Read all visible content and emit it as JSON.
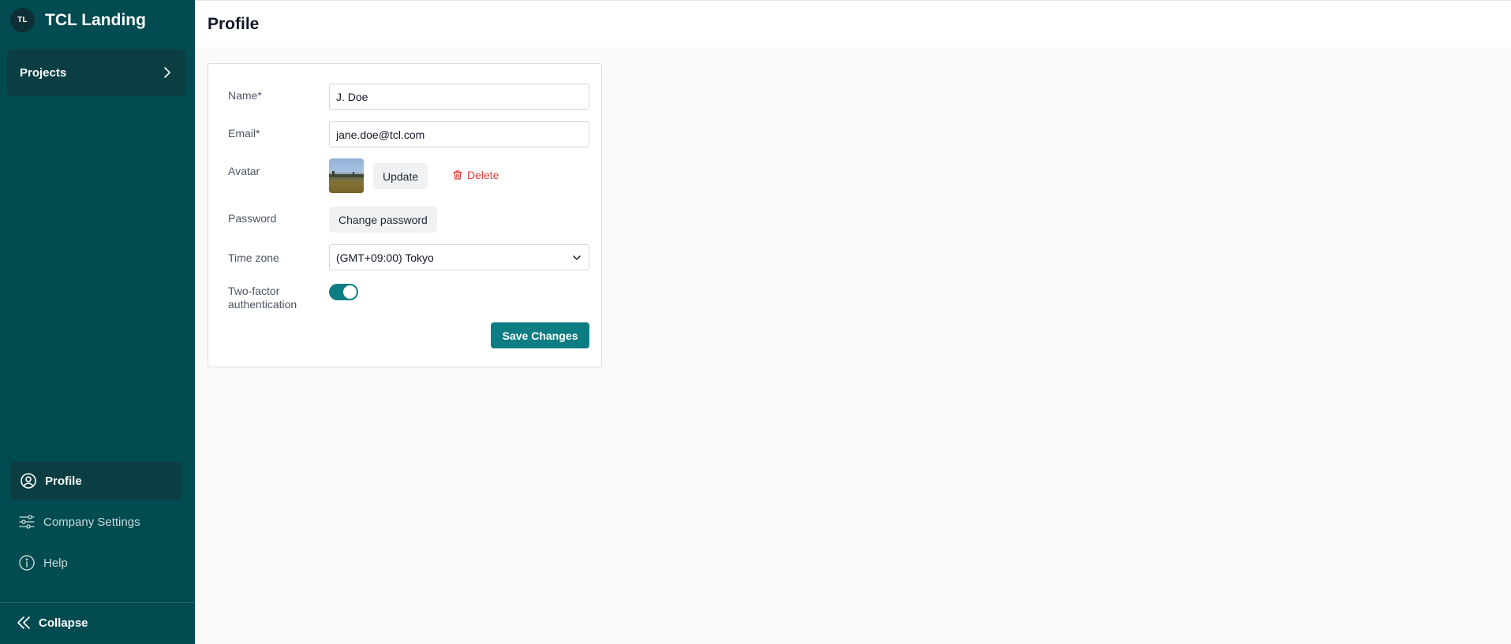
{
  "brand": {
    "initials": "TL",
    "name": "TCL Landing"
  },
  "sidebar": {
    "projects_label": "Projects",
    "nav": [
      {
        "label": "Profile",
        "icon": "user-circle-icon",
        "active": true
      },
      {
        "label": "Company Settings",
        "icon": "sliders-icon",
        "active": false
      },
      {
        "label": "Help",
        "icon": "info-icon",
        "active": false
      }
    ],
    "collapse_label": "Collapse"
  },
  "page": {
    "title": "Profile"
  },
  "form": {
    "name_label": "Name*",
    "name_value": "J. Doe",
    "email_label": "Email*",
    "email_value": "jane.doe@tcl.com",
    "avatar_label": "Avatar",
    "avatar_update_label": "Update",
    "avatar_delete_label": "Delete",
    "password_label": "Password",
    "change_password_label": "Change password",
    "timezone_label": "Time zone",
    "timezone_value": "(GMT+09:00) Tokyo",
    "twofa_label_line1": "Two-factor",
    "twofa_label_line2": "authentication",
    "twofa_enabled": true,
    "save_label": "Save Changes"
  },
  "colors": {
    "sidebar_bg": "#024b50",
    "sidebar_active": "#0b3e42",
    "accent": "#0d7d84",
    "danger": "#e53e3e"
  }
}
